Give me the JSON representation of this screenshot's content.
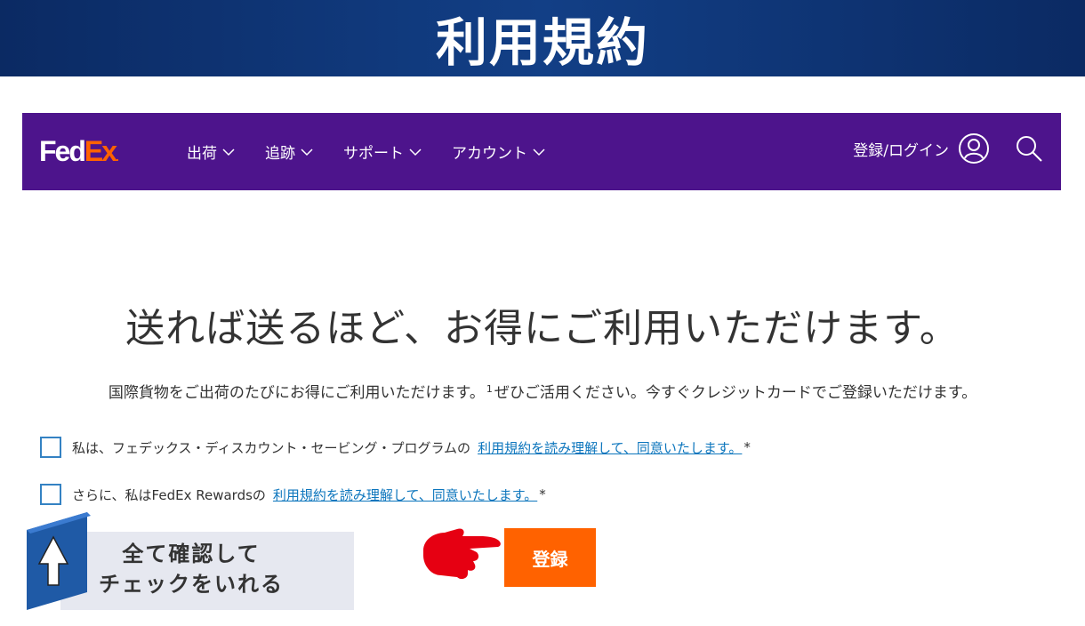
{
  "banner": {
    "title": "利用規約"
  },
  "navbar": {
    "logo": {
      "fed": "Fed",
      "ex": "Ex",
      "dot": "."
    },
    "menu": [
      {
        "label": "出荷",
        "icon": "chevron-down-icon"
      },
      {
        "label": "追跡",
        "icon": "chevron-down-icon"
      },
      {
        "label": "サポート",
        "icon": "chevron-down-icon"
      },
      {
        "label": "アカウント",
        "icon": "chevron-down-icon"
      }
    ],
    "login_label": "登録/ログイン",
    "user_icon": "user-circle-icon",
    "search_icon": "search-icon"
  },
  "main": {
    "headline": "送れば送るほど、お得にご利用いただけます。",
    "subtext_before": "国際貨物をご出荷のたびにお得にご利用いただけます。",
    "subtext_sup": "1",
    "subtext_after": "ぜひご活用ください。今すぐクレジットカードでご登録いただけます。",
    "checkboxes": [
      {
        "text": "私は、フェデックス・ディスカウント・セービング・プログラムの",
        "link": "利用規約を読み理解して、同意いたします。",
        "required": "*",
        "checked": false
      },
      {
        "text": "さらに、私はFedEx Rewardsの",
        "link": "利用規約を読み理解して、同意いたします。",
        "required": "*",
        "checked": false
      }
    ],
    "register_button": "登録"
  },
  "annotation": {
    "line1": "全て確認して",
    "line2": "チェックをいれる",
    "arrow_icon": "up-arrow-icon",
    "hand_icon": "pointing-hand-icon"
  },
  "colors": {
    "fedex_purple": "#4d148c",
    "fedex_orange": "#ff6200",
    "banner_navy": "#0b2a63",
    "link_blue": "#0d76bd"
  }
}
